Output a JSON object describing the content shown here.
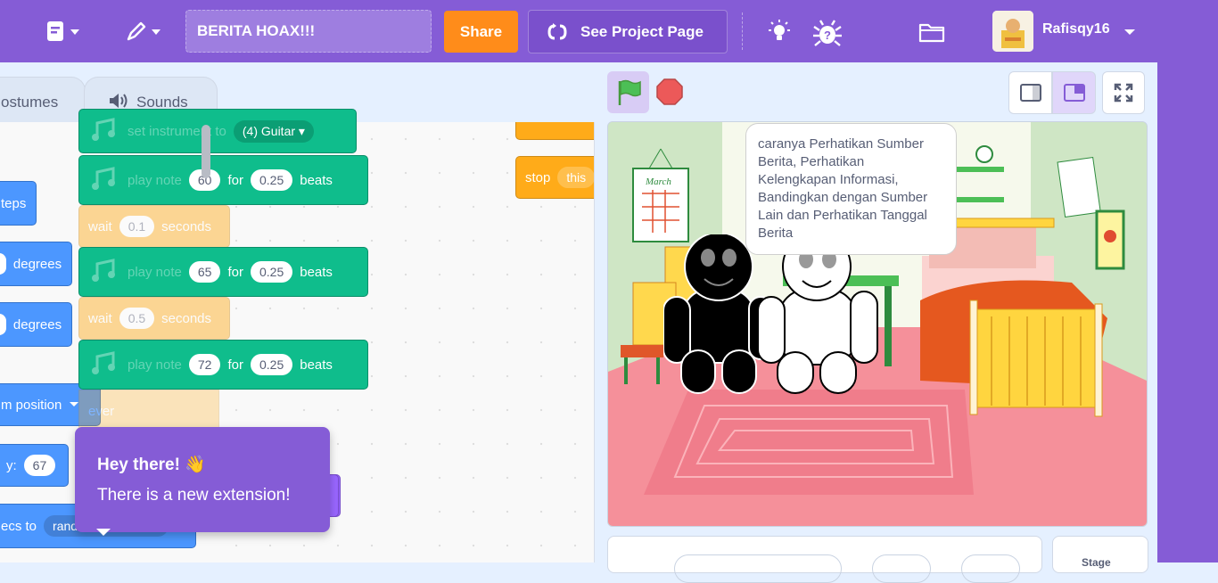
{
  "menu": {
    "project_title": "BERITA HOAX!!!",
    "share_label": "Share",
    "see_project_label": "See Project Page",
    "username": "Rafisqy16"
  },
  "tabs": {
    "costumes": "ostumes",
    "sounds": "Sounds"
  },
  "palette": {
    "steps": "teps",
    "degrees1": "degrees",
    "degrees2": "degrees",
    "position": "m position",
    "y_label": "y:",
    "y_value": "67",
    "glide_to": "ecs to",
    "random": "rand"
  },
  "workspace": {
    "instrument_text": "set instrument to",
    "instrument_value": "(4) Guitar",
    "play_note": "play note",
    "for": "for",
    "beats": "beats",
    "note1": "60",
    "note2": "65",
    "note3": "72",
    "beat_value": "0.25",
    "wait": "wait",
    "seconds": "seconds",
    "wait1": "0.1",
    "wait2": "0.5",
    "forever": "ever",
    "stop": "stop",
    "stop_value": "this"
  },
  "stage": {
    "speech": "caranya Perhatikan Sumber Berita, Perhatikan Kelengkapan Informasi, Bandingkan dengan Sumber Lain dan Perhatikan Tanggal Berita",
    "calendar_text": "March",
    "stage_label": "Stage"
  },
  "tooltip": {
    "title": "Hey there! 👋",
    "body": "There is a new extension!"
  }
}
